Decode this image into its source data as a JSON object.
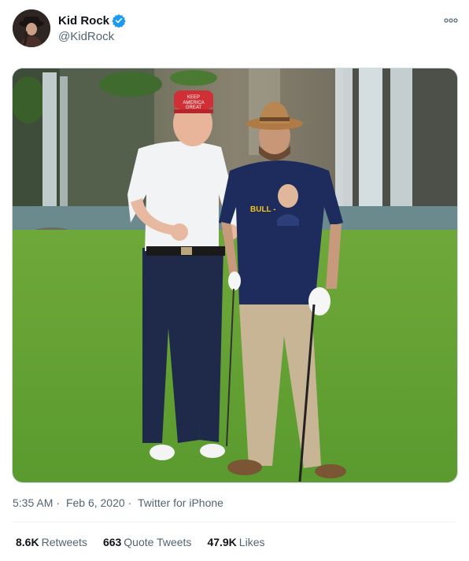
{
  "author": {
    "display_name": "Kid Rock",
    "handle": "@KidRock",
    "verified": true,
    "verified_color": "#1d9bf0"
  },
  "media": {
    "hat_text": "KEEP AMERICA GREAT",
    "shirt_text": "BULL -"
  },
  "meta": {
    "time": "5:35 AM",
    "date": "Feb 6, 2020",
    "separator": "·",
    "source": "Twitter for iPhone"
  },
  "stats": {
    "retweets_count": "8.6K",
    "retweets_label": "Retweets",
    "quotes_count": "663",
    "quotes_label": "Quote Tweets",
    "likes_count": "47.9K",
    "likes_label": "Likes"
  },
  "icons": {
    "more": "more-options-icon",
    "verified": "verified-badge-icon"
  }
}
